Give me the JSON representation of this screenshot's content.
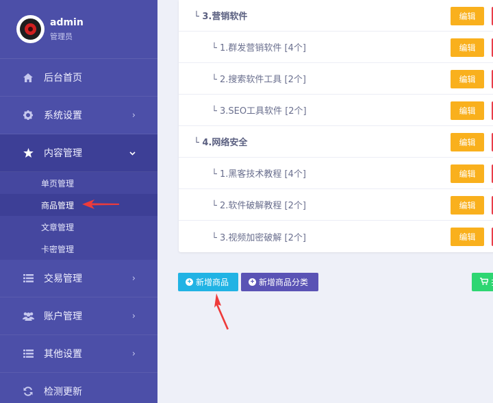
{
  "sidebar": {
    "user": {
      "name": "admin",
      "role": "管理员"
    },
    "nav": [
      {
        "id": "home",
        "label": "后台首页",
        "icon": "home-icon",
        "chevron": ""
      },
      {
        "id": "system",
        "label": "系统设置",
        "icon": "gear-icon",
        "chevron": "›"
      },
      {
        "id": "content",
        "label": "内容管理",
        "icon": "star-icon",
        "chevron": "⌄",
        "active": true
      }
    ],
    "submenu": [
      {
        "label": "单页管理"
      },
      {
        "label": "商品管理",
        "active": true
      },
      {
        "label": "文章管理"
      },
      {
        "label": "卡密管理"
      }
    ],
    "nav_after": [
      {
        "id": "trade",
        "label": "交易管理",
        "icon": "list-icon",
        "chevron": "›"
      },
      {
        "id": "account",
        "label": "账户管理",
        "icon": "users-icon",
        "chevron": "›"
      },
      {
        "id": "other",
        "label": "其他设置",
        "icon": "list-icon",
        "chevron": "›"
      },
      {
        "id": "update",
        "label": "检测更新",
        "icon": "refresh-icon",
        "chevron": ""
      }
    ]
  },
  "categories": [
    {
      "label": "└ 3.营销软件",
      "level": 1
    },
    {
      "label": "└ 1.群发营销软件 [4个]",
      "level": 2
    },
    {
      "label": "└ 2.搜索软件工具 [2个]",
      "level": 2
    },
    {
      "label": "└ 3.SEO工具软件 [2个]",
      "level": 2
    },
    {
      "label": "└ 4.网络安全",
      "level": 1
    },
    {
      "label": "└ 1.黑客技术教程 [4个]",
      "level": 2
    },
    {
      "label": "└ 2.软件破解教程 [2个]",
      "level": 2
    },
    {
      "label": "└ 3.视频加密破解 [2个]",
      "level": 2
    }
  ],
  "edit_label": "编辑",
  "buttons": {
    "add_product": "新增商品",
    "add_category": "新增商品分类",
    "green_button_text": "扌"
  },
  "colors": {
    "sidebar": "#4c4fa8",
    "active": "#3d3f96",
    "edit": "#f9b01d",
    "delete": "#e93d49",
    "add": "#21b3e4",
    "category": "#5a53b5",
    "green": "#2ed672",
    "arrow": "#ee3b3b"
  }
}
